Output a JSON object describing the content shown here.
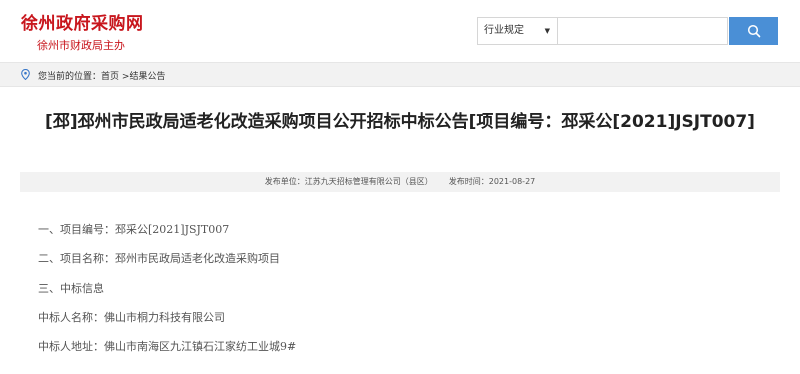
{
  "header": {
    "site_title": "徐州政府采购网",
    "site_subtitle": "徐州市财政局主办",
    "search": {
      "category_selected": "行业规定",
      "caret": "▼",
      "placeholder": "",
      "button_icon": "search-icon",
      "button_color": "#4a8fd6"
    }
  },
  "breadcrumb": {
    "icon": "location-pin-icon",
    "prefix": "您当前的位置：",
    "home": "首页",
    "separator": " >",
    "current": "结果公告"
  },
  "article": {
    "title": "[邳]邳州市民政局适老化改造采购项目公开招标中标公告[项目编号：邳采公[2021]JSJT007]",
    "publisher_label": "发布单位：",
    "publisher": "江苏九天招标管理有限公司（县区）",
    "date_label": "发布时间：",
    "date": "2021-08-27",
    "lines": [
      "一、项目编号：邳采公[2021]JSJT007",
      "二、项目名称：邳州市民政局适老化改造采购项目",
      "三、中标信息",
      "中标人名称：佛山市桐力科技有限公司",
      "中标人地址：佛山市南海区九江镇石江家纺工业城9#"
    ]
  },
  "colors": {
    "brand_red": "#c8161d",
    "accent_blue": "#4a8fd6",
    "bar_gray": "#f2f2f2"
  }
}
